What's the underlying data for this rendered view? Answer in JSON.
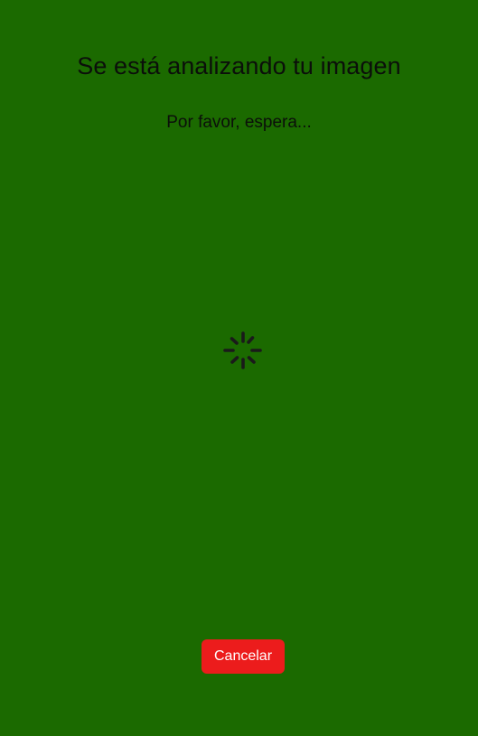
{
  "screen": {
    "title": "Se está analizando tu imagen",
    "subtitle": "Por favor, espera...",
    "loading_icon": "spinner-icon",
    "cancel_label": "Cancelar"
  },
  "colors": {
    "background": "#1b6a00",
    "text": "#0b0f0a",
    "cancel_button": "#ec1c1c",
    "cancel_text": "#ffffff"
  }
}
